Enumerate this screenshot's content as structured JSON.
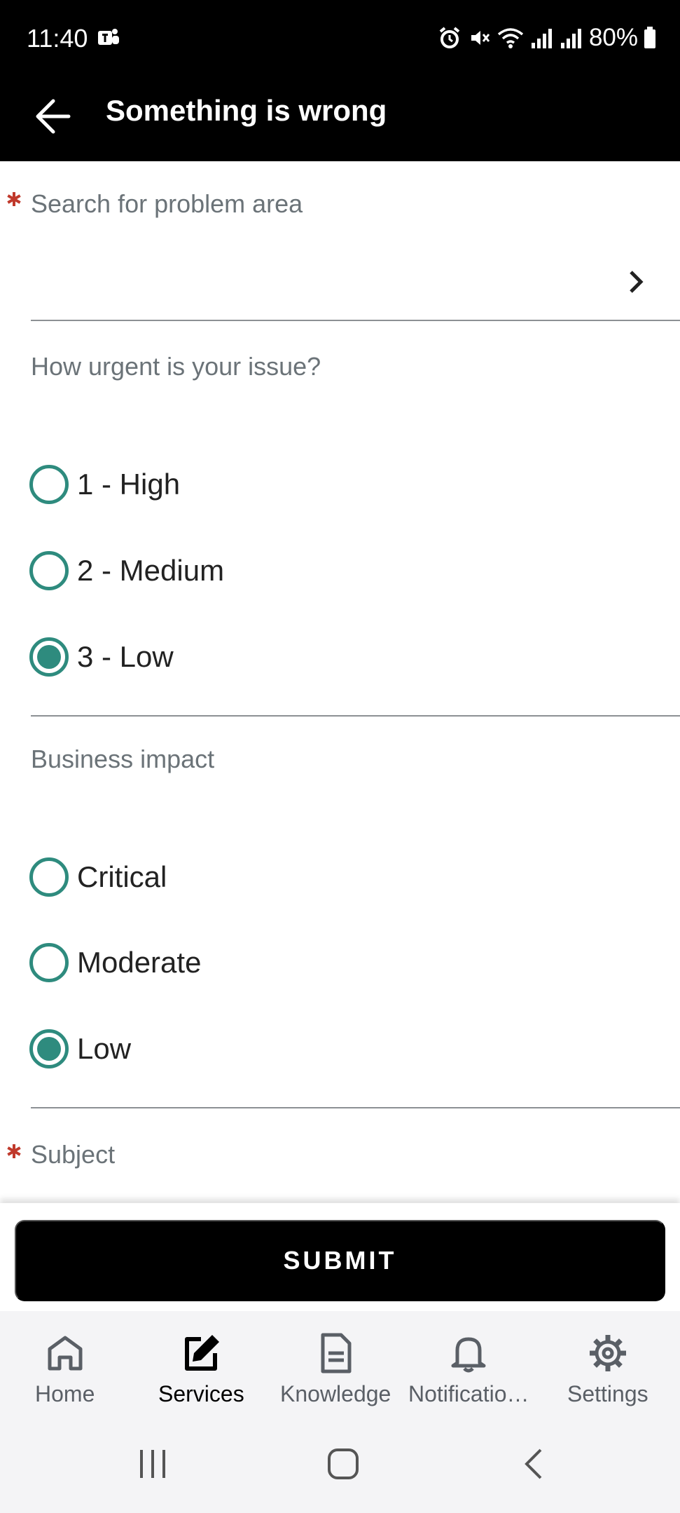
{
  "status_bar": {
    "time": "11:40",
    "battery": "80%"
  },
  "app_bar": {
    "title": "Something is wrong"
  },
  "form": {
    "problem_area": {
      "label": "Search for problem area",
      "required": true,
      "value": ""
    },
    "urgency": {
      "label": "How urgent is your issue?",
      "options": [
        "1 - High",
        "2 - Medium",
        "3 - Low"
      ],
      "selected": "3 - Low"
    },
    "business_impact": {
      "label": "Business impact",
      "options": [
        "Critical",
        "Moderate",
        "Low"
      ],
      "selected": "Low"
    },
    "subject": {
      "label": "Subject",
      "required": true
    }
  },
  "submit_label": "SUBMIT",
  "bottom_nav": {
    "items": [
      {
        "label": "Home",
        "icon": "home-icon",
        "active": false
      },
      {
        "label": "Services",
        "icon": "edit-icon",
        "active": true
      },
      {
        "label": "Knowledge",
        "icon": "document-icon",
        "active": false
      },
      {
        "label": "Notificatio…",
        "icon": "bell-icon",
        "active": false
      },
      {
        "label": "Settings",
        "icon": "gear-icon",
        "active": false
      }
    ]
  },
  "colors": {
    "accent": "#2e8b7e",
    "required": "#c0392b",
    "label": "#6b7378"
  }
}
